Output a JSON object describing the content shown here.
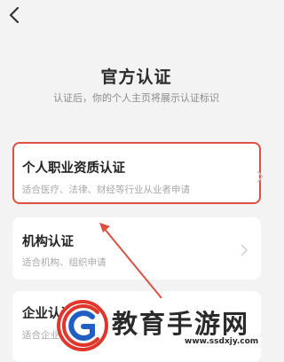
{
  "header": {
    "back_icon": "chevron-left-icon",
    "title": "官方认证",
    "subtitle": "认证后，你的个人主页将展示认证标识"
  },
  "cards": [
    {
      "title": "个人职业资质认证",
      "desc": "适合医疗、法律、财经等行业从业者申请",
      "highlighted": true
    },
    {
      "title": "机构认证",
      "desc": "适合机构、组织申请",
      "highlighted": false
    },
    {
      "title": "企业认证",
      "desc": "适合企业申请",
      "highlighted": false
    }
  ],
  "watermark": {
    "text": "教育手游网",
    "url": "www.ssdxjy.com"
  },
  "colors": {
    "highlight": "#e05040",
    "background": "#f3f3f3",
    "watermark_red": "#e0362c",
    "watermark_blue": "#1f5fc4"
  }
}
